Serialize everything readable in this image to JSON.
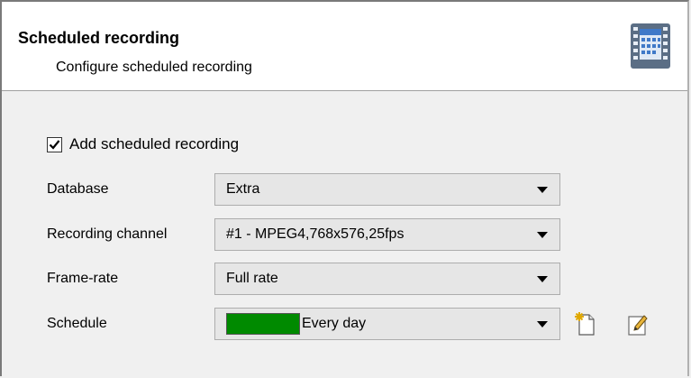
{
  "header": {
    "title": "Scheduled recording",
    "subtitle": "Configure scheduled recording",
    "icon": "calendar-film-icon"
  },
  "form": {
    "add_scheduled": {
      "label": "Add scheduled recording",
      "checked": true
    },
    "database": {
      "label": "Database",
      "value": "Extra"
    },
    "recording_channel": {
      "label": "Recording channel",
      "value": "#1 - MPEG4,768x576,25fps"
    },
    "frame_rate": {
      "label": "Frame-rate",
      "value": "Full rate"
    },
    "schedule": {
      "label": "Schedule",
      "value": "Every day",
      "swatch_color": "#008a00"
    }
  },
  "toolbar": {
    "new_icon": "new-document-icon",
    "edit_icon": "edit-pencil-icon"
  },
  "colors": {
    "header_bg": "#ffffff",
    "body_bg": "#f0f0f0",
    "combo_bg": "#e6e6e6"
  }
}
